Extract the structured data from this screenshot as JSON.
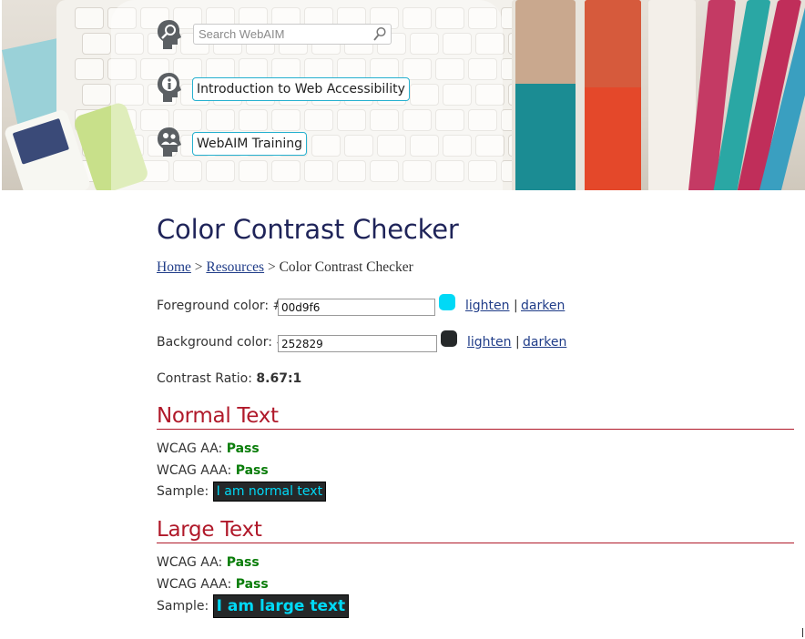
{
  "header": {
    "search": {
      "placeholder": "Search WebAIM"
    },
    "nav": [
      {
        "label": "Introduction to Web Accessibility",
        "icon": "info-icon"
      },
      {
        "label": "WebAIM Training",
        "icon": "people-icon"
      }
    ],
    "icons": {
      "search": "search-person-icon",
      "search_button": "magnifier-icon"
    }
  },
  "page": {
    "title": "Color Contrast Checker",
    "breadcrumb": {
      "home": "Home",
      "sep1": " > ",
      "resources": "Resources",
      "sep2": " > ",
      "current": "Color Contrast Checker"
    }
  },
  "checker": {
    "foreground": {
      "label": "Foreground color: #",
      "value": "00d9f6",
      "color": "#00d9f6",
      "lighten": "lighten",
      "sep": "|",
      "darken": "darken"
    },
    "background": {
      "label": "Background color: #",
      "value": "252829",
      "color": "#252829",
      "lighten": "lighten",
      "sep": "|",
      "darken": "darken"
    },
    "contrast": {
      "label": "Contrast Ratio: ",
      "value": "8.67",
      "suffix": ":1"
    }
  },
  "normal_text": {
    "heading": "Normal Text",
    "aa_label": "WCAG AA: ",
    "aa_result": "Pass",
    "aaa_label": "WCAG AAA: ",
    "aaa_result": "Pass",
    "sample_label": "Sample: ",
    "sample_text": "I am normal text"
  },
  "large_text": {
    "heading": "Large Text",
    "aa_label": "WCAG AA: ",
    "aa_result": "Pass",
    "aaa_label": "WCAG AAA: ",
    "aaa_result": "Pass",
    "sample_label": "Sample: ",
    "sample_text": "I am large text"
  },
  "colors": {
    "heading_blue": "#1f2459",
    "heading_red": "#b0192a",
    "pass_green": "#0a7d0a",
    "link_blue": "#1f3c88",
    "nav_border": "#26b0cf"
  }
}
